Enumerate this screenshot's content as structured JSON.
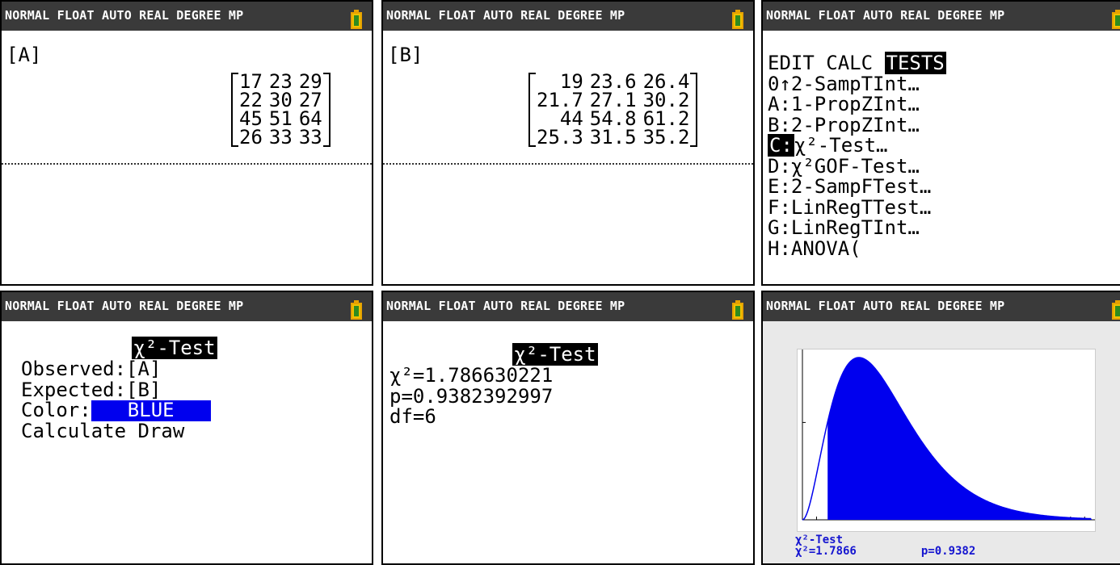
{
  "status": "NORMAL FLOAT AUTO REAL DEGREE MP",
  "screens": {
    "matrixA": {
      "label": "[A]",
      "rows": [
        [
          "17",
          "23",
          "29"
        ],
        [
          "22",
          "30",
          "27"
        ],
        [
          "45",
          "51",
          "64"
        ],
        [
          "26",
          "33",
          "33"
        ]
      ]
    },
    "matrixB": {
      "label": "[B]",
      "rows": [
        [
          "19",
          "23.6",
          "26.4"
        ],
        [
          "21.7",
          "27.1",
          "30.2"
        ],
        [
          "44",
          "54.8",
          "61.2"
        ],
        [
          "25.3",
          "31.5",
          "35.2"
        ]
      ]
    },
    "menu": {
      "tabs": [
        "EDIT",
        "CALC",
        "TESTS"
      ],
      "items": [
        {
          "key": "0↑",
          "label": "2-SampTInt…"
        },
        {
          "key": "A:",
          "label": "1-PropZInt…"
        },
        {
          "key": "B:",
          "label": "2-PropZInt…"
        },
        {
          "key": "C:",
          "label": "χ²-Test…"
        },
        {
          "key": "D:",
          "label": "χ²GOF-Test…"
        },
        {
          "key": "E:",
          "label": "2-SampFTest…"
        },
        {
          "key": "F:",
          "label": "LinRegTTest…"
        },
        {
          "key": "G:",
          "label": "LinRegTInt…"
        },
        {
          "key": "H:",
          "label": "ANOVA("
        }
      ]
    },
    "input": {
      "title": "χ²-Test",
      "observed_label": "Observed:",
      "observed_value": "[A]",
      "expected_label": "Expected:",
      "expected_value": "[B]",
      "color_label": "Color:",
      "color_value": "BLUE",
      "calculate": "Calculate",
      "draw": "Draw"
    },
    "result": {
      "title": "χ²-Test",
      "chi_sq": "χ²=1.786630221",
      "p": "p=0.9382392997",
      "df": "df=6"
    },
    "graph": {
      "caption_title": "χ²-Test",
      "caption_chi": "χ²=1.7866",
      "caption_p": "p=0.9382",
      "df": 6,
      "chi_value": 1.7866,
      "fill_color": "#0000ee"
    }
  },
  "colors": {
    "status_bg": "#3a3a3a",
    "accent_blue": "#0000ee",
    "battery": "#f0c000"
  }
}
